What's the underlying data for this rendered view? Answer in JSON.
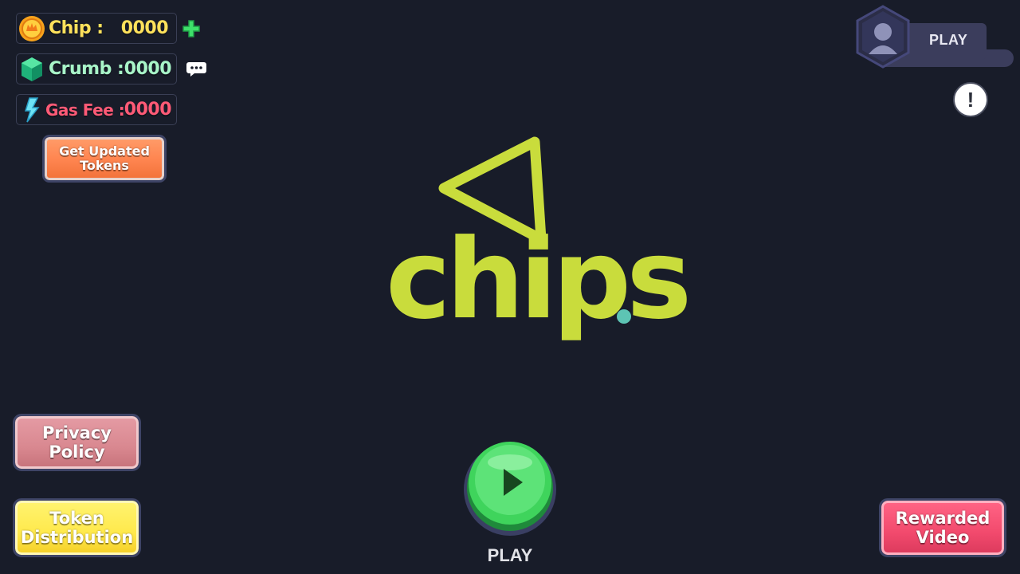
{
  "currency": {
    "chip": {
      "label": "Chip :",
      "value": "0000",
      "icon": "gold-coin-icon"
    },
    "crumb": {
      "label": "Crumb :",
      "value": "0000",
      "icon": "green-gem-icon"
    },
    "gas_fee": {
      "label": "Gas Fee :",
      "value": "0000",
      "icon": "lightning-icon"
    },
    "add_icon": "plus-icon",
    "chat_icon": "chat-bubble-icon"
  },
  "buttons": {
    "get_updated_tokens": "Get Updated Tokens",
    "privacy_policy": "Privacy Policy",
    "token_distribution": "Token Distribution",
    "rewarded_video": "Rewarded Video",
    "play": "PLAY"
  },
  "profile": {
    "label": "PLAY",
    "icon": "user-avatar-icon"
  },
  "info_icon": "exclamation-icon",
  "logo": {
    "word": "chips",
    "dot": "."
  },
  "colors": {
    "background": "#181c29",
    "brand_green": "#c9dc3c",
    "brand_teal": "#5dc4b4",
    "chip_yellow": "#ffe15b",
    "crumb_mint": "#a8f5c8",
    "gas_red": "#ff5a76",
    "play_green": "#3fd45c"
  }
}
